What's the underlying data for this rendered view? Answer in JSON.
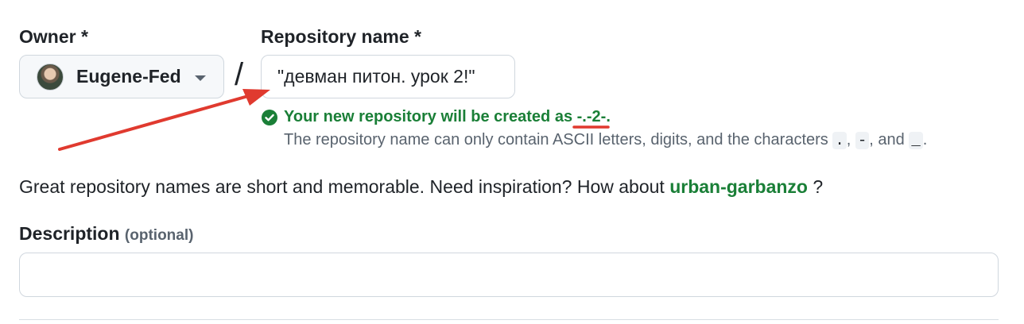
{
  "owner": {
    "label": "Owner *",
    "name": "Eugene-Fed"
  },
  "separator": "/",
  "repository": {
    "label": "Repository name *",
    "value": "\"девман питон. урок 2!\""
  },
  "validation": {
    "prefix": "Your new repository will be created as",
    "created_name": "-.-2-",
    "suffix": ".",
    "help_prefix": "The repository name can only contain ASCII letters, digits, and the characters",
    "char_dot": ".",
    "sep_1": ",",
    "char_dash": "-",
    "sep_2": ", and",
    "char_underscore": "_",
    "help_suffix": "."
  },
  "suggestion": {
    "text": "Great repository names are short and memorable. Need inspiration? How about",
    "link": "urban-garbanzo",
    "end": "?"
  },
  "description": {
    "label": "Description",
    "optional": "(optional)",
    "value": ""
  },
  "colors": {
    "success": "#1a7f37",
    "annotation": "#e03a2f"
  },
  "icons": {
    "owner_dropdown": "caret-down-icon",
    "status": "check-circle-icon"
  }
}
